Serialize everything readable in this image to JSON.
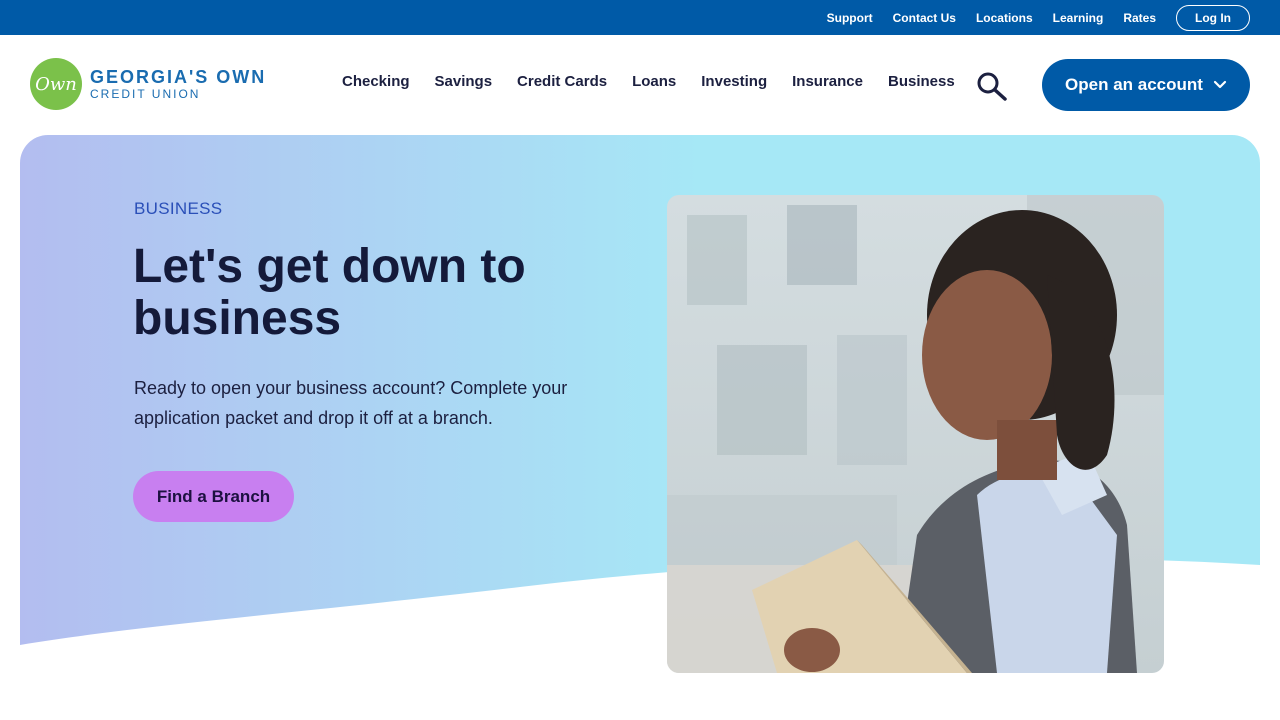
{
  "utility_bar": {
    "links": [
      "Support",
      "Contact Us",
      "Locations",
      "Learning",
      "Rates"
    ],
    "login_label": "Log In",
    "color": "#005aa7"
  },
  "header": {
    "logo": {
      "mark": "Own",
      "line1": "GEORGIA'S OWN",
      "line2": "CREDIT UNION"
    },
    "nav": [
      "Checking",
      "Savings",
      "Credit Cards",
      "Loans",
      "Investing",
      "Insurance",
      "Business"
    ],
    "search_icon": "search-icon",
    "open_account_label": "Open an account"
  },
  "hero": {
    "eyebrow": "BUSINESS",
    "title": "Let's get down to business",
    "description": "Ready to open your business account? Complete your application packet and drop it off at a branch.",
    "button_label": "Find a Branch",
    "button_color": "#c87ff0",
    "gradient_start": "#b3bdf0",
    "gradient_end": "#a6e8f6"
  },
  "photo": {
    "subject": "woman-holding-folder"
  }
}
